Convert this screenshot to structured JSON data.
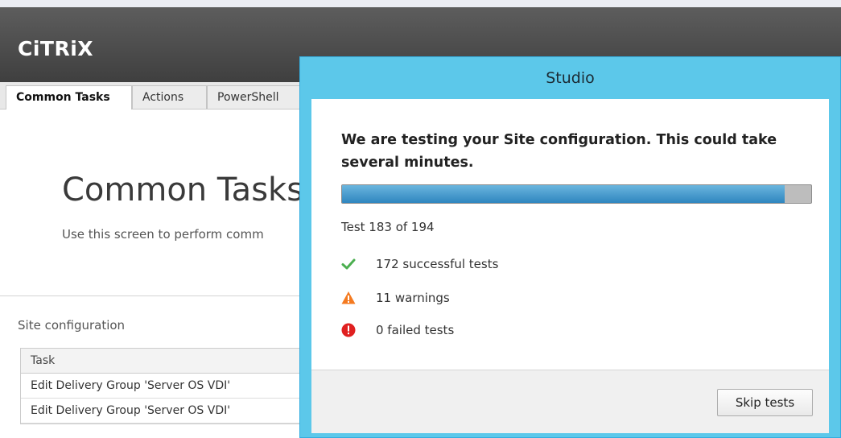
{
  "app": {
    "logo_text": "CiTRiX"
  },
  "tabs": [
    {
      "label": "Common Tasks",
      "active": true
    },
    {
      "label": "Actions",
      "active": false
    },
    {
      "label": "PowerShell",
      "active": false
    }
  ],
  "background_page": {
    "title": "Common Tasks",
    "subtitle": "Use this screen to perform comm",
    "section_label": "Site configuration",
    "table": {
      "header": "Task",
      "rows": [
        "Edit Delivery Group 'Server OS VDI'",
        "Edit Delivery Group 'Server OS VDI'"
      ]
    }
  },
  "dialog": {
    "title": "Studio",
    "heading": "We are testing your Site configuration. This could take several minutes.",
    "progress_fraction": 0.943,
    "test_count_text": "Test 183 of 194",
    "stats": [
      {
        "icon": "check-icon",
        "color": "#4caf50",
        "text": "172 successful tests"
      },
      {
        "icon": "warning-icon",
        "color": "#f47a20",
        "text": "11 warnings"
      },
      {
        "icon": "error-icon",
        "color": "#e02020",
        "text": "0 failed tests"
      }
    ],
    "skip_button_label": "Skip tests"
  },
  "colors": {
    "dialog_frame": "#5cc8ea",
    "header_bar": "#4a4a4a",
    "progress_fill": "#3a92c8"
  }
}
